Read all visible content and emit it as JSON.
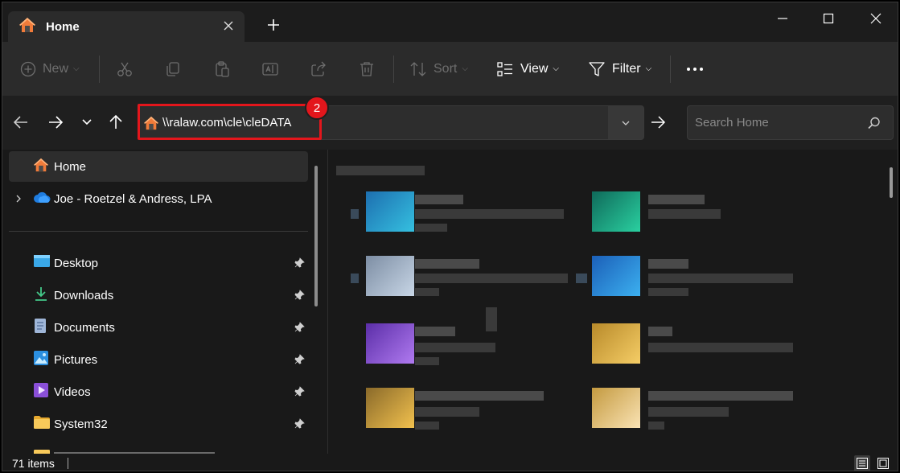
{
  "tab": {
    "title": "Home"
  },
  "toolbar": {
    "new_label": "New",
    "sort_label": "Sort",
    "view_label": "View",
    "filter_label": "Filter"
  },
  "address": {
    "path": "\\\\ralaw.com\\cle\\cleDATA",
    "badge": "2"
  },
  "search": {
    "placeholder": "Search Home"
  },
  "sidebar": {
    "items": [
      {
        "label": "Home"
      },
      {
        "label": "Joe - Roetzel & Andress, LPA"
      },
      {
        "label": "Desktop"
      },
      {
        "label": "Downloads"
      },
      {
        "label": "Documents"
      },
      {
        "label": "Pictures"
      },
      {
        "label": "Videos"
      },
      {
        "label": "System32"
      }
    ]
  },
  "status": {
    "items_count": "71 items"
  },
  "colors": {
    "highlight": "#e3161c",
    "folder": "#f2c14e",
    "accent": "#4cc2ff"
  }
}
